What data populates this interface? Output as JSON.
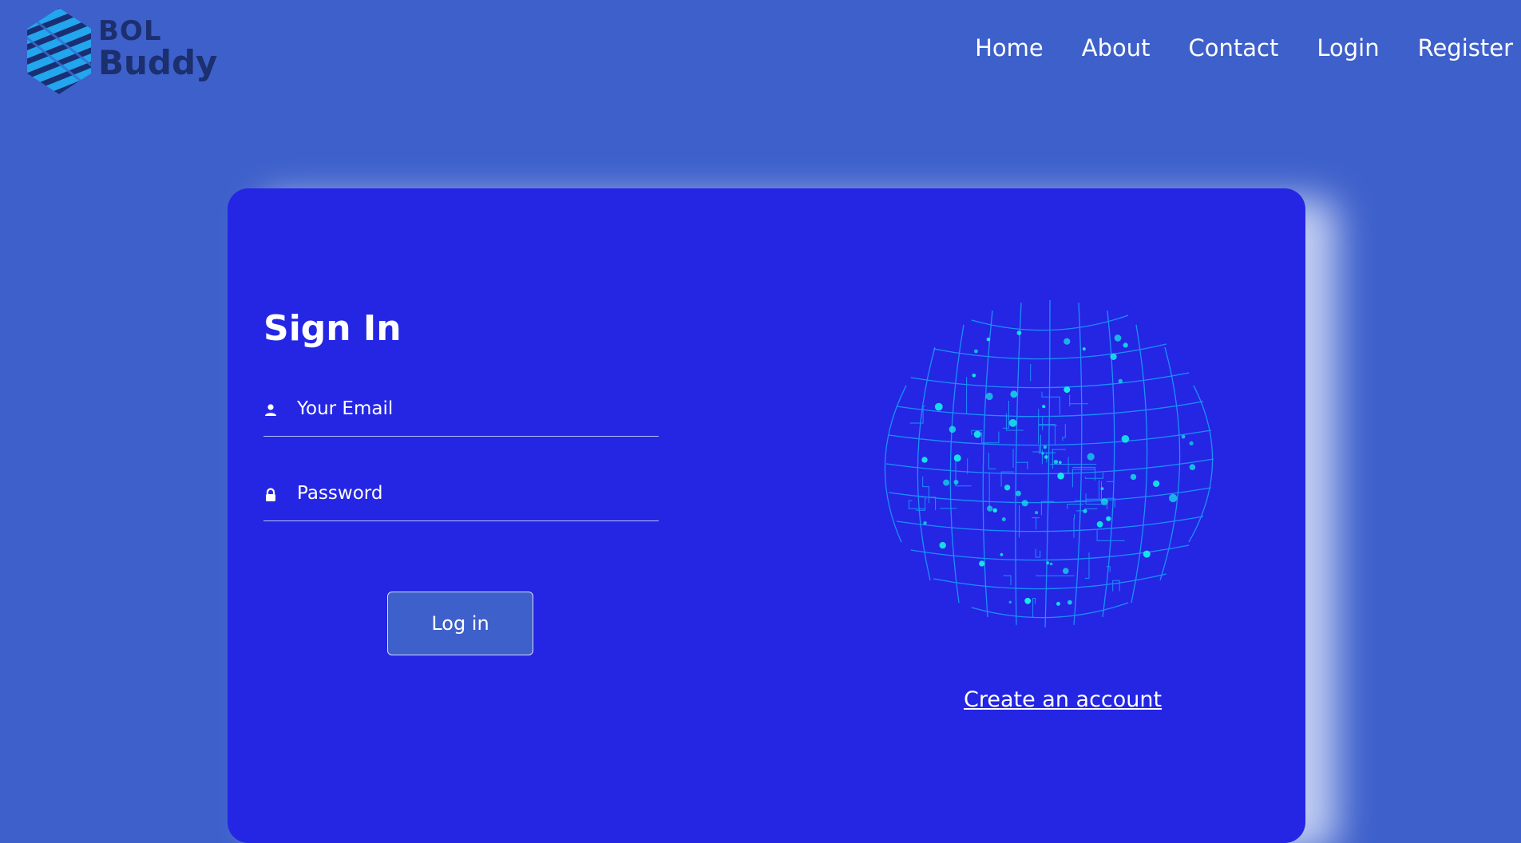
{
  "brand": {
    "line1": "BOL",
    "line2": "Buddy"
  },
  "nav": [
    "Home",
    "About",
    "Contact",
    "Login",
    "Register"
  ],
  "signin": {
    "title": "Sign In",
    "email_placeholder": "Your Email",
    "password_placeholder": "Password",
    "submit_label": "Log in",
    "create_account": "Create an account"
  },
  "icons": {
    "logo": "hexagon-stripes-logo-icon",
    "email": "user-icon",
    "password": "lock-icon",
    "illustration": "digital-globe-illustration"
  },
  "colors": {
    "page_bg": "#3e60cb",
    "card_bg": "#2426e4",
    "accent_dots": "#14f0e8",
    "logo_text": "#1c2f6e"
  }
}
